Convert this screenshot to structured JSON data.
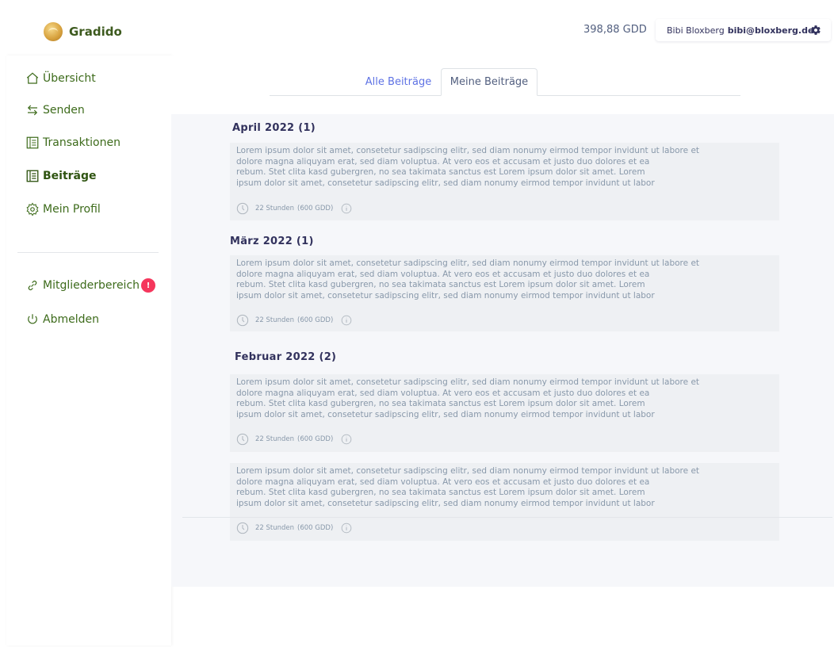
{
  "header": {
    "brand": "Gradido",
    "balance": "398,88 GDD",
    "user_name": "Bibi Bloxberg",
    "user_email": "bibi@bloxberg.de"
  },
  "sidebar": {
    "items": [
      {
        "label": "Übersicht",
        "icon": "house-icon"
      },
      {
        "label": "Senden",
        "icon": "arrows-exchange-icon"
      },
      {
        "label": "Transaktionen",
        "icon": "ledger-icon"
      },
      {
        "label": "Beiträge",
        "icon": "ledger-icon"
      },
      {
        "label": "Mein Profil",
        "icon": "gear-outline-icon"
      }
    ],
    "secondary": [
      {
        "label": "Mitgliederbereich",
        "icon": "link-icon",
        "badge": "!"
      },
      {
        "label": "Abmelden",
        "icon": "power-icon"
      }
    ]
  },
  "tabs": {
    "all": "Alle Beiträge",
    "mine": "Meine Beiträge"
  },
  "months": [
    {
      "title": "April 2022 (1)"
    },
    {
      "title": "März 2022 (1)"
    },
    {
      "title": "Februar 2022 (2)"
    }
  ],
  "post_text": {
    "line1": "Lorem ipsum dolor sit amet, consetetur sadipscing elitr, sed diam nonumy eirmod tempor invidunt ut labore et",
    "line2": "dolore magna aliquyam erat, sed diam voluptua. At vero eos et accusam et justo duo dolores et ea",
    "line3": "rebum. Stet clita kasd gubergren, no sea takimata sanctus est Lorem ipsum dolor sit amet. Lorem",
    "line4": "ipsum dolor sit amet, consetetur sadipscing elitr, sed diam nonumy eirmod tempor invidunt ut labor"
  },
  "post_meta": {
    "hours": "22 Stunden",
    "amount": "(600 GDD)"
  },
  "colors": {
    "brand_green": "#3d6b1b",
    "tab_active_link": "#5e72e4",
    "badge_red": "#f5365c"
  }
}
